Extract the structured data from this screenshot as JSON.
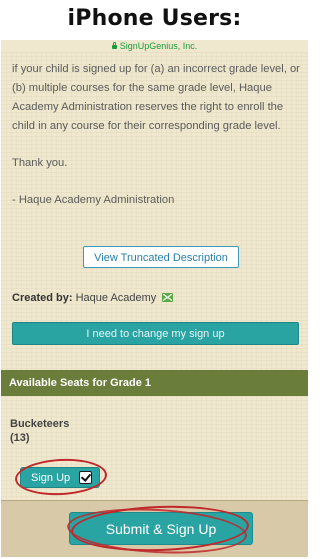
{
  "page_heading": "iPhone Users:",
  "browser": {
    "url_label": "SignUpGenius, Inc."
  },
  "description": {
    "paragraph": "if your child is signed up for (a) an incorrect grade level, or (b) multiple courses for the same grade level, Haque Academy Administration reserves the right to enroll the child in any course for their corresponding grade level.",
    "thanks": "Thank you.",
    "signature": "- Haque Academy Administration"
  },
  "buttons": {
    "view_truncated": "View Truncated Description",
    "change_signup": "I need to change my sign up",
    "signup": "Sign Up",
    "submit": "Submit & Sign Up"
  },
  "created_by": {
    "label": "Created by:",
    "name": "Haque Academy"
  },
  "seats_section": {
    "title": "Available Seats for Grade 1"
  },
  "slot": {
    "name": "Bucketeers",
    "count": "(13)",
    "checked": true
  },
  "colors": {
    "accent_teal": "#2aa3a3",
    "section_bar": "#6b7d3a",
    "annotation_red": "#c0282b",
    "url_green": "#1d9c3c"
  },
  "icons": {
    "url": "lock-icon",
    "creator": "mail-icon",
    "signup": "checkbox-checked-icon"
  }
}
